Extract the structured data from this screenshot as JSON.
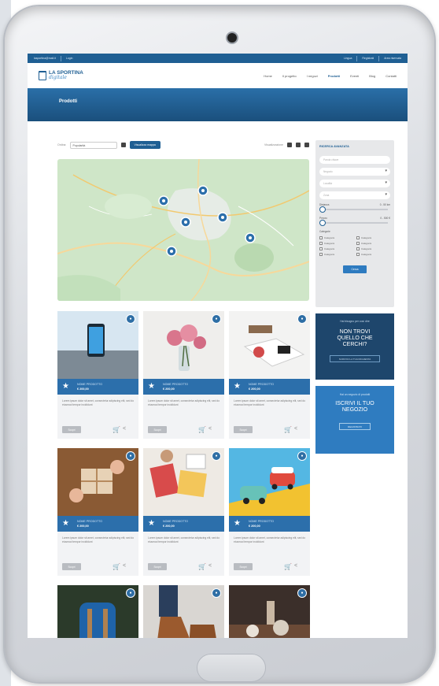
{
  "topbar": {
    "items": [
      "lasportina@mail.it",
      "Login",
      "Lingua",
      "Registrati",
      "Area riservata"
    ]
  },
  "brand": {
    "line1": "LA SPORTINA",
    "line2": "digitale"
  },
  "menu": [
    "Home",
    "Il progetto",
    "I negozi",
    "Prodotti",
    "Eventi",
    "Blog",
    "Contatti"
  ],
  "menu_active": "Prodotti",
  "hero": {
    "title": "Prodotti"
  },
  "filters": {
    "order_label": "Ordina",
    "order_value": "Popolarità",
    "map_button": "Visualizza mappa",
    "view_label": "Visualizzazione"
  },
  "products": [
    {
      "name": "NOME PRODOTTO",
      "price": "€ 200,00",
      "desc": "Lorem ipsum dolor sit amet, consectetur adipiscing elit, sed do eiusmod tempor incididunt",
      "more": "Scopri",
      "image": "smartphone"
    },
    {
      "name": "NOME PRODOTTO",
      "price": "€ 200,00",
      "desc": "Lorem ipsum dolor sit amet, consectetur adipiscing elit, sed do eiusmod tempor incididunt",
      "more": "Scopri",
      "image": "flowers"
    },
    {
      "name": "NOME PRODOTTO",
      "price": "€ 200,00",
      "desc": "Lorem ipsum dolor sit amet, consectetur adipiscing elit, sed do eiusmod tempor incididunt",
      "more": "Scopri",
      "image": "notebook"
    },
    {
      "name": "NOME PRODOTTO",
      "price": "€ 200,00",
      "desc": "Lorem ipsum dolor sit amet, consectetur adipiscing elit, sed do eiusmod tempor incididunt",
      "more": "Scopri",
      "image": "gift"
    },
    {
      "name": "NOME PRODOTTO",
      "price": "€ 200,00",
      "desc": "Lorem ipsum dolor sit amet, consectetur adipiscing elit, sed do eiusmod tempor incididunt",
      "more": "Scopri",
      "image": "magazines"
    },
    {
      "name": "NOME PRODOTTO",
      "price": "€ 200,00",
      "desc": "Lorem ipsum dolor sit amet, consectetur adipiscing elit, sed do eiusmod tempor incididunt",
      "more": "Scopri",
      "image": "toy-cars"
    },
    {
      "name": "",
      "price": "",
      "desc": "",
      "more": "",
      "image": "backpack"
    },
    {
      "name": "",
      "price": "",
      "desc": "",
      "more": "",
      "image": "boots"
    },
    {
      "name": "",
      "price": "",
      "desc": "",
      "more": "",
      "image": "table"
    }
  ],
  "search": {
    "title": "RICERCA AVANZATA",
    "keyword_placeholder": "Parola chiave",
    "select1": "Negozio",
    "select2": "Località",
    "select3": "Zona",
    "range1_label": "Distanza",
    "range1_value": "0 - 50 km",
    "range2_label": "Prezzo",
    "range2_value": "0 - 500 €",
    "categories_label": "Categorie",
    "categories": [
      "Categoria",
      "Categoria",
      "Categoria",
      "Categoria",
      "Categoria",
      "Categoria",
      "Categoria",
      "Categoria"
    ],
    "button": "Cerca"
  },
  "promo1": {
    "small": "Hai bisogno per così dire",
    "big1": "NON TROVI",
    "big2": "QUELLO CHE",
    "big3": "CERCHI?",
    "button": "SCRIVICI LA TUA RICHIESTA"
  },
  "promo2": {
    "small": "Hai un negozio di prodotti",
    "big1": "ISCRIVI IL TUO",
    "big2": "NEGOZIO",
    "button": "REGISTRATI"
  },
  "colors": {
    "primary": "#1f5f93",
    "accent": "#2c6fab",
    "hero": "#1a4f7c"
  }
}
